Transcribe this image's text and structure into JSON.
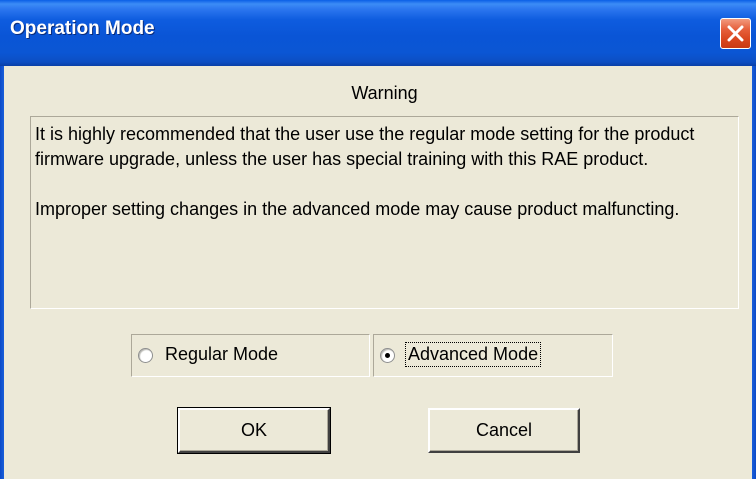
{
  "window": {
    "title": "Operation Mode",
    "close_icon": "close-icon"
  },
  "warning": {
    "heading": "Warning",
    "paragraph1": "It is highly recommended that the user use the regular mode setting for the product firmware upgrade, unless the user has special training with this RAE product.",
    "paragraph2": "Improper setting changes in the advanced mode may cause product malfuncting."
  },
  "mode": {
    "regular_label": "Regular Mode",
    "advanced_label": "Advanced Mode",
    "selected": "Advanced Mode"
  },
  "buttons": {
    "ok_label": "OK",
    "cancel_label": "Cancel"
  },
  "colors": {
    "titlebar": "#0A55D6",
    "close_button": "#D9461E",
    "dialog_background": "#ECE9D8"
  }
}
